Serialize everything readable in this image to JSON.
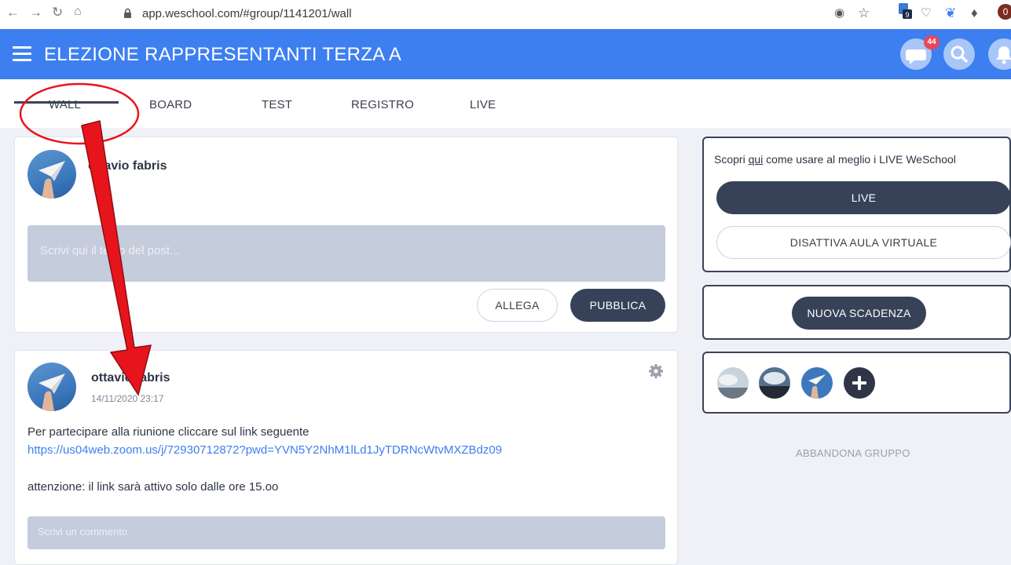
{
  "browser": {
    "url": "app.weschool.com/#group/1141201/wall",
    "profile_initial": "0",
    "ext_badge": "9"
  },
  "header": {
    "title": "ELEZIONE RAPPRESENTANTI TERZA A",
    "chat_badge": "44"
  },
  "tabs": [
    {
      "label": "WALL"
    },
    {
      "label": "BOARD"
    },
    {
      "label": "TEST"
    },
    {
      "label": "REGISTRO"
    },
    {
      "label": "LIVE"
    }
  ],
  "composer": {
    "author": "ottavio fabris",
    "placeholder": "Scrivi qui il testo del post...",
    "attach_label": "ALLEGA",
    "publish_label": "PUBBLICA"
  },
  "post": {
    "author": "ottavio fabris",
    "timestamp": "14/11/2020 23:17",
    "line1": "Per partecipare alla riunione cliccare sul link seguente",
    "link": "https://us04web.zoom.us/j/72930712872?pwd=YVN5Y2NhM1lLd1JyTDRNcWtvMXZBdz09",
    "line2": "attenzione: il link sarà attivo solo dalle ore 15.oo",
    "comment_placeholder": "Scrivi un commento"
  },
  "sidebar": {
    "promo_before": "Scopri ",
    "promo_link": "qui",
    "promo_after": " come usare al meglio i LIVE WeSchool",
    "live_label": "LIVE",
    "disable_label": "DISATTIVA AULA VIRTUALE",
    "deadline_label": "NUOVA SCADENZA",
    "leave_label": "ABBANDONA GRUPPO"
  },
  "colors": {
    "brand_blue": "#3d7ff0",
    "dark_button": "#374258",
    "annotation_red": "#e8141c"
  }
}
